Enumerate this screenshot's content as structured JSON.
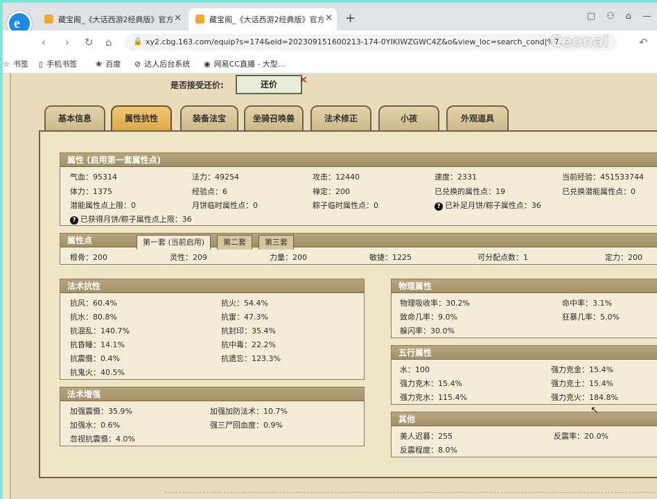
{
  "browser": {
    "tabs": [
      {
        "title": "藏宝阁_《大话西游2经典版》官方",
        "active": false
      },
      {
        "title": "藏宝阁_《大话西游2经典版》官方",
        "active": true
      }
    ],
    "new_tab": "+",
    "url": "xy2.cbg.163.com/equip?s=174&eid=202309151600213-174-0YIKIWZGWC4Z&o&view_loc=search_cond|%7...",
    "bookmarks": [
      "书签",
      "手机书签",
      "百度",
      "达人后台系统",
      "网易CC直播 - 大型..."
    ],
    "watermark": "Ceonal"
  },
  "bargain": {
    "label": "是否接受还价:",
    "button": "还价"
  },
  "main_tabs": [
    "基本信息",
    "属性抗性",
    "装备法宝",
    "坐骑召唤兽",
    "法术修正",
    "小孩",
    "外观道具"
  ],
  "active_tab": "属性抗性",
  "attributes": {
    "title": "属性 (启用第一套属性点)",
    "rows": [
      [
        "气血：95314",
        "法力：49254",
        "攻击：12440",
        "速度：2331",
        "当前经验：451533744"
      ],
      [
        "体力：1375",
        "经验点：6",
        "禅定：200",
        "已兑换的属性点：19",
        "已兑换潜能属性点：0"
      ],
      [
        "潜能属性点上限：0",
        "月饼临时属性点：0",
        "粽子临时属性点：0",
        "已补足月饼/粽子属性点：36"
      ]
    ],
    "note": "已获得月饼/粽子属性点上限：36"
  },
  "points": {
    "title": "属性点",
    "sets": [
      "第一套 (当前启用)",
      "第二套",
      "第三套"
    ],
    "values": [
      "根骨：200",
      "灵性：209",
      "力量：200",
      "敏捷：1225",
      "可分配点数：1",
      "定力：200"
    ]
  },
  "resist": {
    "title": "法术抗性",
    "items": [
      "抗风：60.4%",
      "抗火：54.4%",
      "抗水：80.8%",
      "抗雷：47.3%",
      "抗混乱：140.7%",
      "抗封印：35.4%",
      "抗昏睡：14.1%",
      "抗中毒：22.2%",
      "抗震慑：0.4%",
      "抗遗忘：123.3%",
      "抗鬼火：40.5%"
    ]
  },
  "boost": {
    "title": "法术增强",
    "items": [
      "加强震慑：35.9%",
      "加强加防法术：10.7%",
      "加强水：0.6%",
      "强三尸回血度：0.9%",
      "忽视抗震慑：4.0%"
    ]
  },
  "physical": {
    "title": "物理属性",
    "items": [
      "物理吸收率：30.2%",
      "命中率：3.1%",
      "致命几率：9.0%",
      "狂暴几率：5.0%",
      "躲闪率：30.0%"
    ]
  },
  "five": {
    "title": "五行属性",
    "items": [
      "水：100",
      "强力克金：15.4%",
      "强力克木：15.4%",
      "强力克土：15.4%",
      "强力克水：115.4%",
      "强力克火：184.8%"
    ]
  },
  "other": {
    "title": "其他",
    "items": [
      "美人迟暮：255",
      "反震率：20.0%",
      "反震程度：8.0%"
    ]
  }
}
